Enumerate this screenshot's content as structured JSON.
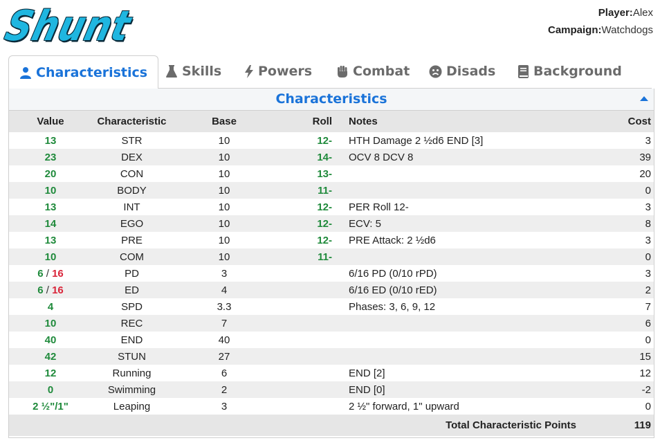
{
  "app": {
    "logo_text": "Shunt"
  },
  "player": {
    "player_label": "Player:",
    "player_name": "Alex",
    "campaign_label": "Campaign:",
    "campaign_name": "Watchdogs"
  },
  "tabs": [
    {
      "label": "Characteristics",
      "icon": "user-icon",
      "active": true
    },
    {
      "label": "Skills",
      "icon": "flask-icon"
    },
    {
      "label": "Powers",
      "icon": "lightning-icon"
    },
    {
      "label": "Combat",
      "icon": "fist-icon"
    },
    {
      "label": "Disads",
      "icon": "frown-icon"
    },
    {
      "label": "Background",
      "icon": "book-icon"
    }
  ],
  "panel": {
    "title": "Characteristics",
    "columns": {
      "value": "Value",
      "characteristic": "Characteristic",
      "base": "Base",
      "roll": "Roll",
      "notes": "Notes",
      "cost": "Cost"
    },
    "rows": [
      {
        "value": "13",
        "name": "STR",
        "base": "10",
        "roll": "12-",
        "notes": "HTH Damage 2 ½d6 END [3]",
        "cost": "3"
      },
      {
        "value": "23",
        "name": "DEX",
        "base": "10",
        "roll": "14-",
        "notes": "OCV 8 DCV 8",
        "cost": "39"
      },
      {
        "value": "20",
        "name": "CON",
        "base": "10",
        "roll": "13-",
        "notes": "",
        "cost": "20"
      },
      {
        "value": "10",
        "name": "BODY",
        "base": "10",
        "roll": "11-",
        "notes": "",
        "cost": "0"
      },
      {
        "value": "13",
        "name": "INT",
        "base": "10",
        "roll": "12-",
        "notes": "PER Roll 12-",
        "cost": "3"
      },
      {
        "value": "14",
        "name": "EGO",
        "base": "10",
        "roll": "12-",
        "notes": "ECV: 5",
        "cost": "8"
      },
      {
        "value": "13",
        "name": "PRE",
        "base": "10",
        "roll": "12-",
        "notes": "PRE Attack: 2 ½d6",
        "cost": "3"
      },
      {
        "value": "10",
        "name": "COM",
        "base": "10",
        "roll": "11-",
        "notes": "",
        "cost": "0"
      },
      {
        "value": "6",
        "value_max": "16",
        "name": "PD",
        "base": "3",
        "roll": "",
        "notes": "6/16 PD (0/10 rPD)",
        "cost": "3"
      },
      {
        "value": "6",
        "value_max": "16",
        "name": "ED",
        "base": "4",
        "roll": "",
        "notes": "6/16 ED (0/10 rED)",
        "cost": "2"
      },
      {
        "value": "4",
        "name": "SPD",
        "base": "3.3",
        "roll": "",
        "notes": "Phases: 3, 6, 9, 12",
        "cost": "7"
      },
      {
        "value": "10",
        "name": "REC",
        "base": "7",
        "roll": "",
        "notes": "",
        "cost": "6"
      },
      {
        "value": "40",
        "name": "END",
        "base": "40",
        "roll": "",
        "notes": "",
        "cost": "0"
      },
      {
        "value": "42",
        "name": "STUN",
        "base": "27",
        "roll": "",
        "notes": "",
        "cost": "15"
      },
      {
        "value": "12",
        "name": "Running",
        "base": "6",
        "roll": "",
        "notes": "END [2]",
        "cost": "12"
      },
      {
        "value": "0",
        "name": "Swimming",
        "base": "2",
        "roll": "",
        "notes": "END [0]",
        "cost": "-2"
      },
      {
        "value": "2 ½\"/1\"",
        "name": "Leaping",
        "base": "3",
        "roll": "",
        "notes": "2 ½\" forward, 1\" upward",
        "cost": "0"
      }
    ],
    "total_label": "Total Characteristic Points",
    "total_value": "119"
  },
  "colors": {
    "accent": "#1a73d9",
    "value_green": "#1f8a3b",
    "max_red": "#d9253a",
    "logo": "#1fb6e0"
  }
}
